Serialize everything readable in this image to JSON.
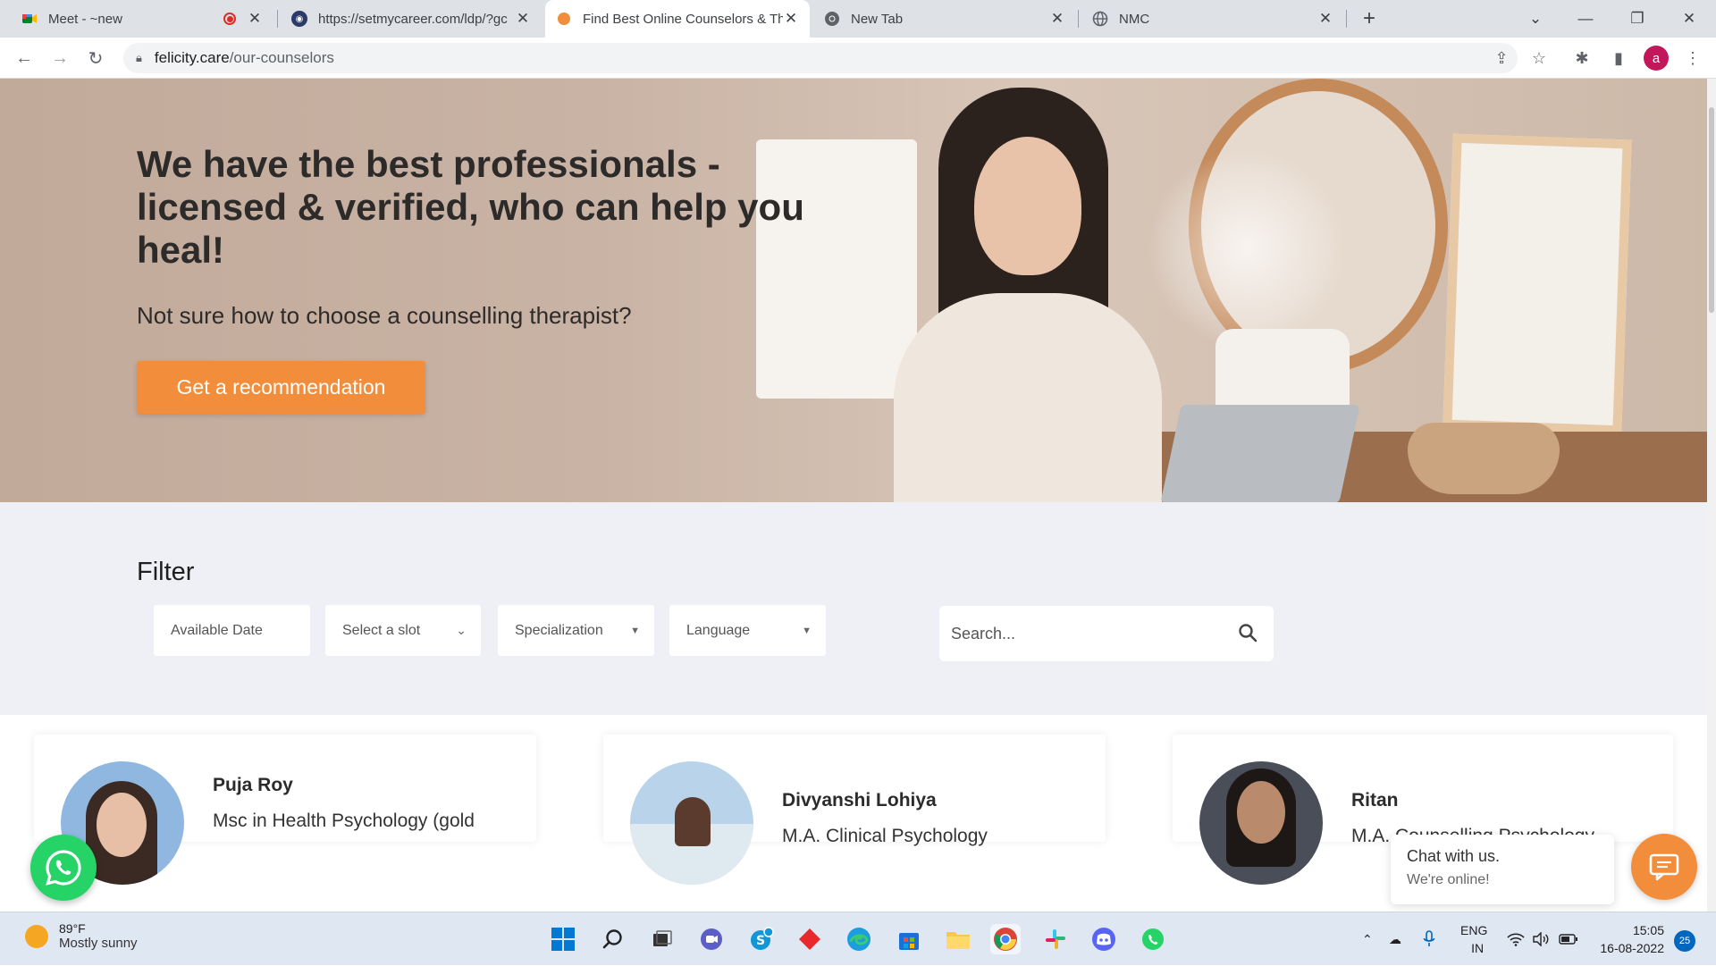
{
  "browser": {
    "tabs": [
      {
        "title": "Meet - ~new",
        "favicon": "google-meet-icon",
        "recording": true
      },
      {
        "title": "https://setmycareer.com/ldp/?gc",
        "favicon": "site-icon"
      },
      {
        "title": "Find Best Online Counselors & Th",
        "favicon": "felicity-icon",
        "active": true
      },
      {
        "title": "New Tab",
        "favicon": "chrome-icon"
      },
      {
        "title": "NMC",
        "favicon": "globe-icon"
      }
    ],
    "new_tab_label": "+",
    "url_domain": "felicity.care",
    "url_path": "/our-counselors",
    "profile_initial": "a"
  },
  "hero": {
    "title": "We have the best professionals - licensed & verified, who can help you heal!",
    "subtitle": "Not sure how to choose a counselling therapist?",
    "cta_label": "Get a recommendation"
  },
  "filter": {
    "title": "Filter",
    "date_placeholder": "Available Date",
    "slot_placeholder": "Select a slot",
    "specialization_placeholder": "Specialization",
    "language_placeholder": "Language",
    "search_placeholder": "Search..."
  },
  "counselors": [
    {
      "name": "Puja Roy",
      "degree": "Msc in Health Psychology (gold"
    },
    {
      "name": "Divyanshi Lohiya",
      "degree": "M.A. Clinical Psychology"
    },
    {
      "name": "Ritan",
      "degree": "M.A. Counselling Psychology"
    }
  ],
  "chat_widget": {
    "line1": "Chat with us.",
    "line2": "We're online!"
  },
  "taskbar": {
    "temperature": "89°F",
    "weather": "Mostly sunny",
    "lang1": "ENG",
    "lang2": "IN",
    "time": "15:05",
    "date": "16-08-2022",
    "notification_count": "25"
  },
  "colors": {
    "accent": "#f28d3b",
    "whatsapp": "#25d366"
  }
}
